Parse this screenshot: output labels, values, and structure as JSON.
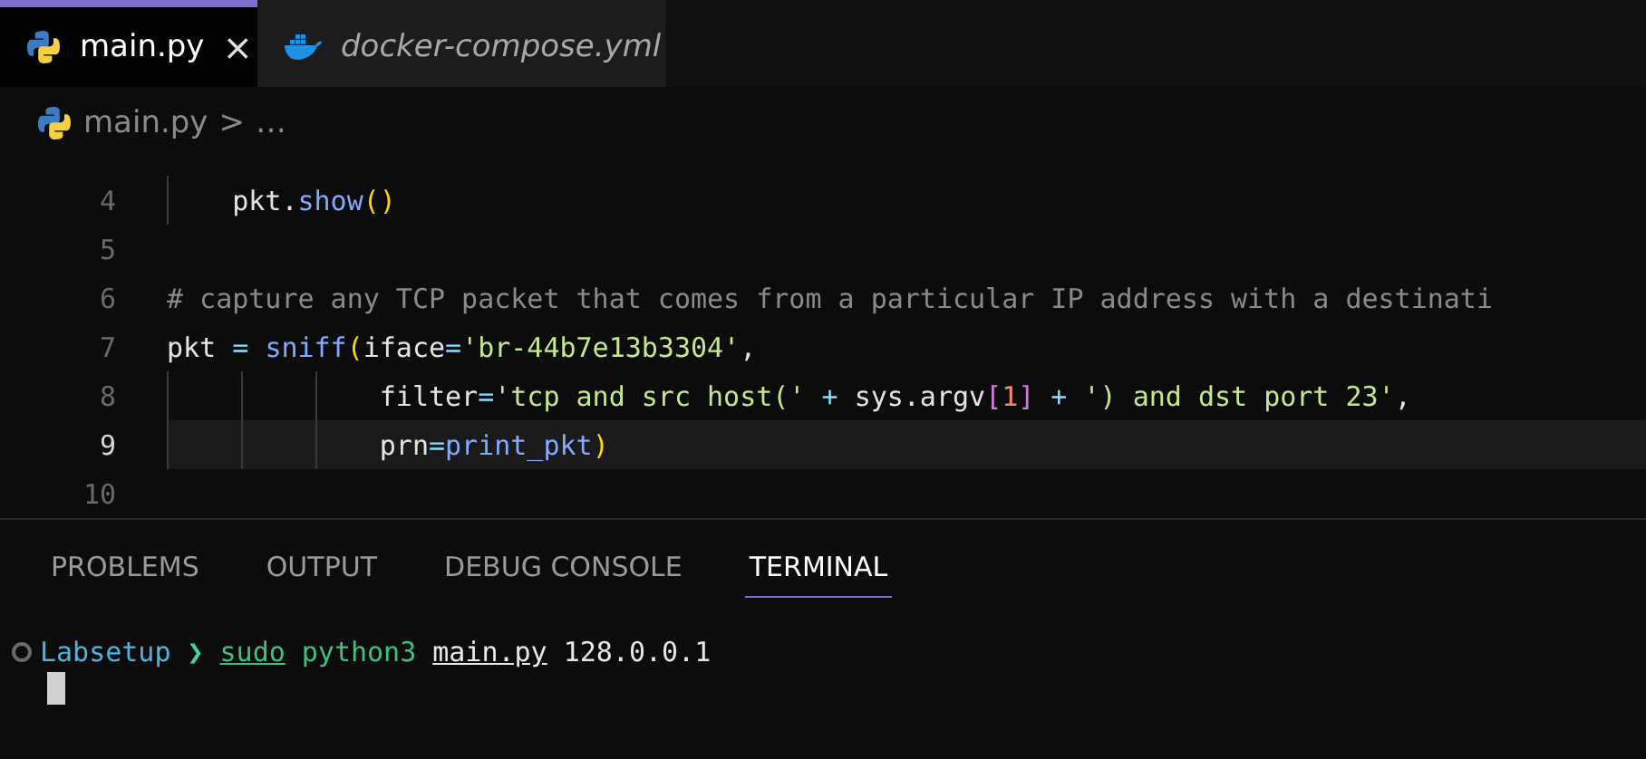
{
  "tabs": [
    {
      "label": "main.py",
      "selected": true,
      "italic": false,
      "close": "×"
    },
    {
      "label": "docker-compose.yml",
      "selected": false,
      "italic": true
    }
  ],
  "breadcrumb": {
    "file": "main.py",
    "separator": ">",
    "rest": "…"
  },
  "editor": {
    "lines": [
      {
        "number": "4",
        "current": false,
        "kind": "body",
        "tokens": [
          {
            "kind": "plain",
            "text": "    pkt."
          },
          {
            "kind": "func",
            "text": "show"
          },
          {
            "kind": "paren",
            "text": "()"
          }
        ]
      },
      {
        "number": "5",
        "current": false,
        "kind": "blank"
      },
      {
        "number": "6",
        "current": false,
        "kind": "top",
        "tokens": [
          {
            "kind": "comment",
            "text": "# capture any TCP packet that comes from a particular IP address with a destinati"
          }
        ]
      },
      {
        "number": "7",
        "current": false,
        "kind": "top",
        "tokens": [
          {
            "kind": "plain",
            "text": "pkt"
          },
          {
            "kind": "op",
            "text": " = "
          },
          {
            "kind": "func",
            "text": "sniff"
          },
          {
            "kind": "paren",
            "text": "("
          },
          {
            "kind": "plain",
            "text": "iface"
          },
          {
            "kind": "op",
            "text": "="
          },
          {
            "kind": "string",
            "text": "'br-44b7e13b3304'"
          },
          {
            "kind": "plain",
            "text": ","
          }
        ]
      },
      {
        "number": "8",
        "current": false,
        "kind": "continuation",
        "tokens": [
          {
            "kind": "plain",
            "text": "             filter"
          },
          {
            "kind": "op",
            "text": "="
          },
          {
            "kind": "string",
            "text": "'tcp and src host('"
          },
          {
            "kind": "op",
            "text": " + "
          },
          {
            "kind": "plain",
            "text": "sys.argv"
          },
          {
            "kind": "bracket",
            "text": "["
          },
          {
            "kind": "number",
            "text": "1"
          },
          {
            "kind": "bracket",
            "text": "]"
          },
          {
            "kind": "op",
            "text": " + "
          },
          {
            "kind": "string",
            "text": "') and dst port 23'"
          },
          {
            "kind": "plain",
            "text": ","
          }
        ]
      },
      {
        "number": "9",
        "current": true,
        "kind": "continuation",
        "tokens": [
          {
            "kind": "plain",
            "text": "             prn"
          },
          {
            "kind": "op",
            "text": "="
          },
          {
            "kind": "func",
            "text": "print_pkt"
          },
          {
            "kind": "paren",
            "text": ")"
          }
        ]
      },
      {
        "number": "10",
        "current": false,
        "kind": "blank"
      }
    ]
  },
  "panel_tabs": [
    {
      "label": "PROBLEMS",
      "selected": false
    },
    {
      "label": "OUTPUT",
      "selected": false
    },
    {
      "label": "DEBUG CONSOLE",
      "selected": false
    },
    {
      "label": "TERMINAL",
      "selected": true
    }
  ],
  "terminal": {
    "prompt": [
      {
        "kind": "dir",
        "text": "Labsetup"
      },
      {
        "kind": "arrow",
        "text": "❯"
      },
      {
        "kind": "cmd",
        "text": "sudo"
      },
      {
        "kind": "cmdplain",
        "text": "python3"
      },
      {
        "kind": "path",
        "text": "main.py"
      },
      {
        "kind": "arg",
        "text": "128.0.0.1"
      }
    ]
  }
}
